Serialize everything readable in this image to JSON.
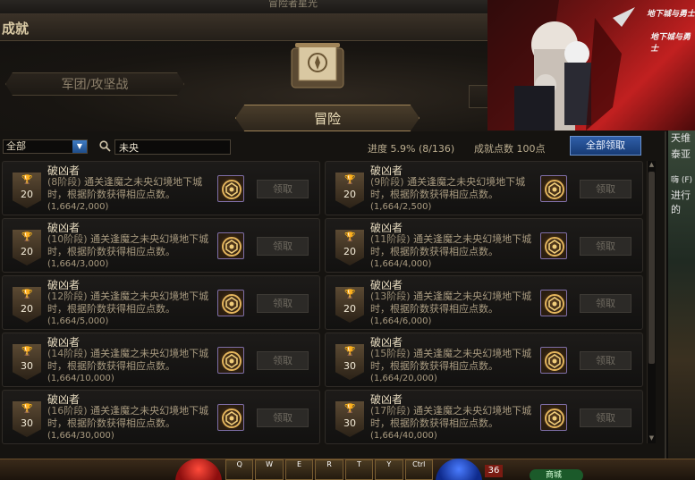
{
  "window_title": "冒险者星光",
  "panel": {
    "title": "成就"
  },
  "tabs": {
    "left": "军团/攻坚战",
    "active": "冒险"
  },
  "filter": {
    "category": "全部",
    "search_value": "未央"
  },
  "stats": {
    "progress": "进度  5.9% (8/136)",
    "points": "成就点数 100点"
  },
  "claim_all_label": "全部领取",
  "cards": [
    {
      "name": "破凶者",
      "stage": "(8阶段)",
      "desc": "通关逢魔之未央幻境地下城时，根据阶数获得相应点数。",
      "progress": "(1,664/2,000)",
      "points": "20",
      "claim": "领取"
    },
    {
      "name": "破凶者",
      "stage": "(9阶段)",
      "desc": "通关逢魔之未央幻境地下城时，根据阶数获得相应点数。",
      "progress": "(1,664/2,500)",
      "points": "20",
      "claim": "领取"
    },
    {
      "name": "破凶者",
      "stage": "(10阶段)",
      "desc": "通关逢魔之未央幻境地下城时，根据阶数获得相应点数。",
      "progress": "(1,664/3,000)",
      "points": "20",
      "claim": "领取"
    },
    {
      "name": "破凶者",
      "stage": "(11阶段)",
      "desc": "通关逢魔之未央幻境地下城时，根据阶数获得相应点数。",
      "progress": "(1,664/4,000)",
      "points": "20",
      "claim": "领取"
    },
    {
      "name": "破凶者",
      "stage": "(12阶段)",
      "desc": "通关逢魔之未央幻境地下城时，根据阶数获得相应点数。",
      "progress": "(1,664/5,000)",
      "points": "20",
      "claim": "领取"
    },
    {
      "name": "破凶者",
      "stage": "(13阶段)",
      "desc": "通关逢魔之未央幻境地下城时，根据阶数获得相应点数。",
      "progress": "(1,664/6,000)",
      "points": "20",
      "claim": "领取"
    },
    {
      "name": "破凶者",
      "stage": "(14阶段)",
      "desc": "通关逢魔之未央幻境地下城时，根据阶数获得相应点数。",
      "progress": "(1,664/10,000)",
      "points": "30",
      "claim": "领取"
    },
    {
      "name": "破凶者",
      "stage": "(15阶段)",
      "desc": "通关逢魔之未央幻境地下城时，根据阶数获得相应点数。",
      "progress": "(1,664/20,000)",
      "points": "30",
      "claim": "领取"
    },
    {
      "name": "破凶者",
      "stage": "(16阶段)",
      "desc": "通关逢魔之未央幻境地下城时，根据阶数获得相应点数。",
      "progress": "(1,664/30,000)",
      "points": "30",
      "claim": "领取"
    },
    {
      "name": "破凶者",
      "stage": "(17阶段)",
      "desc": "通关逢魔之未央幻境地下城时，根据阶数获得相应点数。",
      "progress": "(1,664/40,000)",
      "points": "30",
      "claim": "领取"
    }
  ],
  "side_texts": [
    "天维",
    "泰亚",
    "嗨 (F)",
    "进行的"
  ],
  "promo_logo": "地下城与勇士",
  "hud": {
    "level": "36",
    "shop": "商城",
    "skills": [
      "Q",
      "W",
      "E",
      "R",
      "T",
      "Y",
      "Ctrl"
    ]
  },
  "colors": {
    "accent_blue": "#2f5ea8",
    "gold_border": "#a08458",
    "panel_bg": "#151310"
  }
}
